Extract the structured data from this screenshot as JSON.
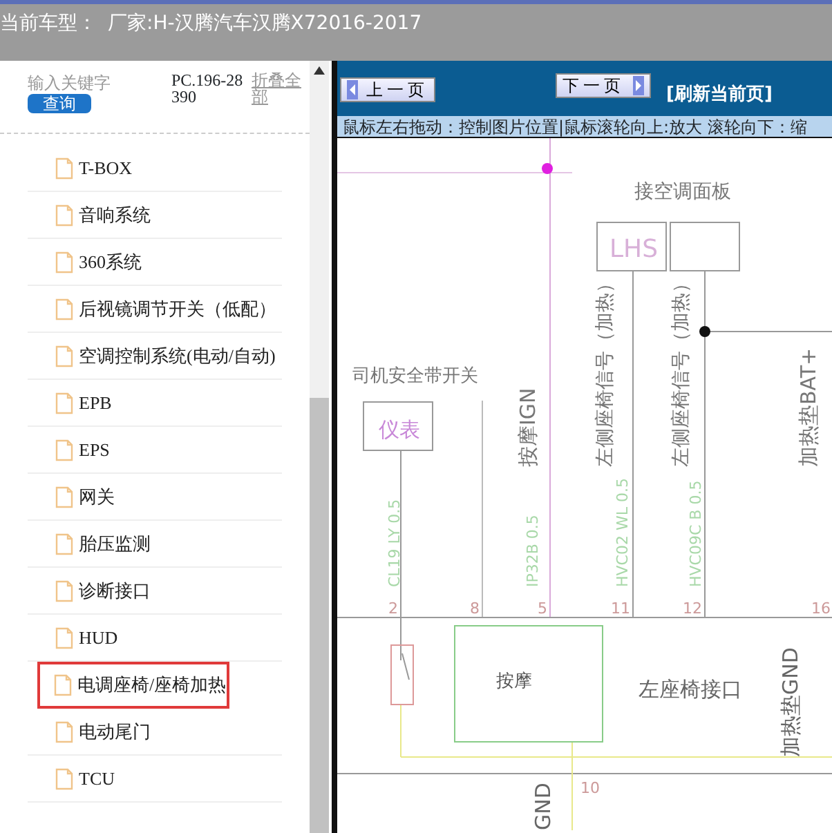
{
  "header": {
    "label": "当前车型：",
    "value": "厂家:H-汉腾汽车汉腾X72016-2017"
  },
  "sidebar": {
    "search": {
      "placeholder": "输入关键字"
    },
    "search_button": "查询",
    "code": "PC.196-28390",
    "collapse_link": "折叠全部",
    "items": [
      {
        "label": "T-BOX",
        "selected": false
      },
      {
        "label": "音响系统",
        "selected": false
      },
      {
        "label": "360系统",
        "selected": false
      },
      {
        "label": "后视镜调节开关（低配）",
        "selected": false
      },
      {
        "label": "空调控制系统(电动/自动)",
        "selected": false
      },
      {
        "label": "EPB",
        "selected": false
      },
      {
        "label": "EPS",
        "selected": false
      },
      {
        "label": "网关",
        "selected": false
      },
      {
        "label": "胎压监测",
        "selected": false
      },
      {
        "label": "诊断接口",
        "selected": false
      },
      {
        "label": "HUD",
        "selected": false
      },
      {
        "label": "电调座椅/座椅加热",
        "selected": true
      },
      {
        "label": "电动尾门",
        "selected": false
      },
      {
        "label": "TCU",
        "selected": false
      }
    ]
  },
  "viewer": {
    "prev_button": "上一页",
    "next_button": "下一页",
    "refresh_link": "[刷新当前页]",
    "hint": "鼠标左右拖动：控制图片位置|鼠标滚轮向上:放大  滚轮向下：缩",
    "diagram": {
      "labels": [
        {
          "text": "接空调面板",
          "kind": "horizontal"
        },
        {
          "text": "LHS",
          "kind": "box"
        },
        {
          "text": "司机安全带开关",
          "kind": "horizontal"
        },
        {
          "text": "仪表",
          "kind": "box"
        },
        {
          "text": "按摩IGN",
          "kind": "vertical"
        },
        {
          "text": "左侧座椅信号（加热）",
          "kind": "vertical"
        },
        {
          "text": "左侧座椅信号（加热）",
          "kind": "vertical"
        },
        {
          "text": "加热垫BAT+",
          "kind": "vertical"
        },
        {
          "text": "CL19 LY 0.5",
          "kind": "wire"
        },
        {
          "text": "IP32B 0.5",
          "kind": "wire"
        },
        {
          "text": "HVC02 WL 0.5",
          "kind": "wire"
        },
        {
          "text": "HVC09C B 0.5",
          "kind": "wire"
        },
        {
          "text": "2",
          "kind": "pin"
        },
        {
          "text": "8",
          "kind": "pin"
        },
        {
          "text": "5",
          "kind": "pin"
        },
        {
          "text": "11",
          "kind": "pin"
        },
        {
          "text": "12",
          "kind": "pin"
        },
        {
          "text": "16",
          "kind": "pin"
        },
        {
          "text": "按摩",
          "kind": "box"
        },
        {
          "text": "左座椅接口",
          "kind": "horizontal"
        },
        {
          "text": "加热垫GND",
          "kind": "vertical"
        },
        {
          "text": "10",
          "kind": "pin"
        },
        {
          "text": "GND",
          "kind": "vertical"
        }
      ]
    }
  }
}
